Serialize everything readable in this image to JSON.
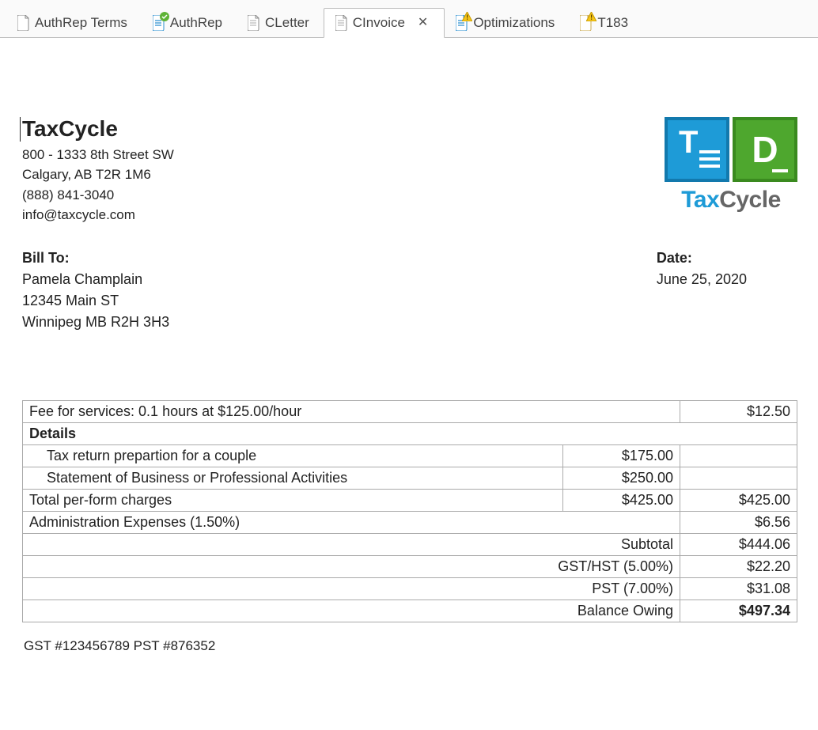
{
  "tabs": [
    {
      "label": "AuthRep Terms",
      "icon": "plain",
      "active": false
    },
    {
      "label": "AuthRep",
      "icon": "blue-check",
      "active": false
    },
    {
      "label": "CLetter",
      "icon": "plain",
      "active": false
    },
    {
      "label": "CInvoice",
      "icon": "plain",
      "active": true
    },
    {
      "label": "Optimizations",
      "icon": "blue-warn",
      "active": false
    },
    {
      "label": "T183",
      "icon": "folded-warn",
      "active": false
    }
  ],
  "company": {
    "name": "TaxCycle",
    "addr1": "800 - 1333 8th Street SW",
    "addr2": "Calgary, AB  T2R 1M6",
    "phone": "(888) 841-3040",
    "email": "info@taxcycle.com"
  },
  "logo": {
    "word1": "Tax",
    "word2": "Cycle"
  },
  "billto": {
    "label": "Bill To:",
    "name": "Pamela Champlain",
    "addr1": "12345 Main ST",
    "addr2": "Winnipeg MB  R2H 3H3"
  },
  "date": {
    "label": "Date:",
    "value": "June 25, 2020"
  },
  "rows": {
    "fee_desc": "Fee for services: 0.1 hours at $125.00/hour",
    "fee_amt": "$12.50",
    "details_hdr": "Details",
    "line1_desc": "Tax return prepartion for a couple",
    "line1_amt": "$175.00",
    "line2_desc": "Statement of Business or Professional Activities",
    "line2_amt": "$250.00",
    "totalpf_desc": "Total per-form charges",
    "totalpf_sub": "$425.00",
    "totalpf_amt": "$425.00",
    "admin_desc": "Administration Expenses (1.50%)",
    "admin_amt": "$6.56",
    "subtotal_lbl": "Subtotal",
    "subtotal_amt": "$444.06",
    "gst_lbl": "GST/HST (5.00%)",
    "gst_amt": "$22.20",
    "pst_lbl": "PST (7.00%)",
    "pst_amt": "$31.08",
    "bal_lbl": "Balance Owing",
    "bal_amt": "$497.34"
  },
  "footer": "GST #123456789 PST #876352"
}
